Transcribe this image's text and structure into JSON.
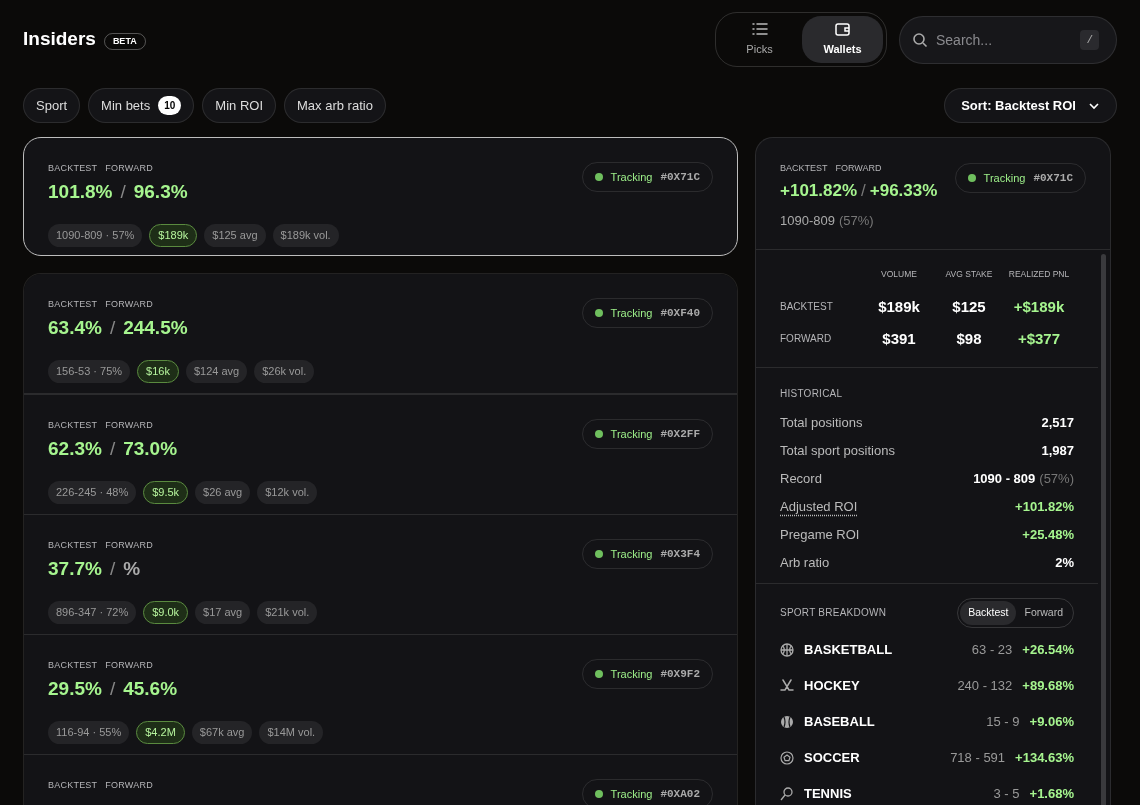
{
  "header": {
    "title": "Insiders",
    "badge": "BETA"
  },
  "view_toggle": [
    {
      "label": "Picks",
      "selected": false
    },
    {
      "label": "Wallets",
      "selected": true
    }
  ],
  "search": {
    "placeholder": "Search...",
    "shortcut": "/"
  },
  "filters": [
    {
      "label": "Sport"
    },
    {
      "label": "Min bets",
      "count": "10"
    },
    {
      "label": "Min ROI"
    },
    {
      "label": "Max arb ratio"
    }
  ],
  "sort": {
    "label": "Sort: Backtest ROI"
  },
  "wallets": [
    {
      "selected": true,
      "backtest_label": "BACKTEST",
      "forward_label": "FORWARD",
      "backtest": "101.8%",
      "separator": "/",
      "forward": "96.3%",
      "forward_positive": true,
      "status": "Tracking",
      "id": "#0X71C",
      "record": "1090-809 · 57%",
      "pnl": "$189k",
      "avg": "$125 avg",
      "volume": "$189k vol."
    },
    {
      "selected": false,
      "backtest_label": "BACKTEST",
      "forward_label": "FORWARD",
      "backtest": "63.4%",
      "separator": "/",
      "forward": "244.5%",
      "forward_positive": true,
      "status": "Tracking",
      "id": "#0XF40",
      "record": "156-53 · 75%",
      "pnl": "$16k",
      "avg": "$124 avg",
      "volume": "$26k vol."
    },
    {
      "selected": false,
      "backtest_label": "BACKTEST",
      "forward_label": "FORWARD",
      "backtest": "62.3%",
      "separator": "/",
      "forward": "73.0%",
      "forward_positive": true,
      "status": "Tracking",
      "id": "#0X2FF",
      "record": "226-245 · 48%",
      "pnl": "$9.5k",
      "avg": "$26 avg",
      "volume": "$12k vol."
    },
    {
      "selected": false,
      "backtest_label": "BACKTEST",
      "forward_label": "FORWARD",
      "backtest": "37.7%",
      "separator": "/",
      "forward": "%",
      "forward_positive": false,
      "status": "Tracking",
      "id": "#0X3F4",
      "record": "896-347 · 72%",
      "pnl": "$9.0k",
      "avg": "$17 avg",
      "volume": "$21k vol."
    },
    {
      "selected": false,
      "backtest_label": "BACKTEST",
      "forward_label": "FORWARD",
      "backtest": "29.5%",
      "separator": "/",
      "forward": "45.6%",
      "forward_positive": true,
      "status": "Tracking",
      "id": "#0X9F2",
      "record": "116-94 · 55%",
      "pnl": "$4.2M",
      "avg": "$67k avg",
      "volume": "$14M vol."
    },
    {
      "selected": false,
      "backtest_label": "BACKTEST",
      "forward_label": "FORWARD",
      "status": "Tracking",
      "id": "#0XA02"
    }
  ],
  "detail": {
    "backtest_label": "BACKTEST",
    "forward_label": "FORWARD",
    "backtest": "+101.82%",
    "separator": "/",
    "forward": "+96.33%",
    "status": "Tracking",
    "id": "#0X71C",
    "record": "1090-809",
    "record_pct": "(57%)",
    "stats": {
      "columns": [
        "VOLUME",
        "AVG STAKE",
        "REALIZED PNL"
      ],
      "rows": [
        {
          "label": "BACKTEST",
          "values": [
            "$189k",
            "$125",
            "+$189k"
          ]
        },
        {
          "label": "FORWARD",
          "values": [
            "$391",
            "$98",
            "+$377"
          ]
        }
      ]
    },
    "historical": {
      "title": "HISTORICAL",
      "rows": [
        {
          "label": "Total positions",
          "value": "2,517",
          "positive": false,
          "underlined": false
        },
        {
          "label": "Total sport positions",
          "value": "1,987",
          "positive": false,
          "underlined": false
        },
        {
          "label": "Record",
          "value": "1090 - 809",
          "note": "(57%)",
          "positive": false,
          "underlined": false
        },
        {
          "label": "Adjusted ROI",
          "value": "+101.82%",
          "positive": true,
          "underlined": true
        },
        {
          "label": "Pregame ROI",
          "value": "+25.48%",
          "positive": true,
          "underlined": false
        },
        {
          "label": "Arb ratio",
          "value": "2%",
          "positive": false,
          "underlined": false
        }
      ]
    },
    "breakdown": {
      "title": "SPORT BREAKDOWN",
      "tabs": [
        {
          "label": "Backtest",
          "selected": true
        },
        {
          "label": "Forward",
          "selected": false
        }
      ],
      "sports": [
        {
          "kind": "basketball",
          "name": "BASKETBALL",
          "record": "63 - 23",
          "roi": "+26.54%"
        },
        {
          "kind": "hockey",
          "name": "HOCKEY",
          "record": "240 - 132",
          "roi": "+89.68%"
        },
        {
          "kind": "baseball",
          "name": "BASEBALL",
          "record": "15 - 9",
          "roi": "+9.06%"
        },
        {
          "kind": "soccer",
          "name": "SOCCER",
          "record": "718 - 591",
          "roi": "+134.63%"
        },
        {
          "kind": "tennis",
          "name": "TENNIS",
          "record": "3 - 5",
          "roi": "+1.68%"
        }
      ]
    }
  }
}
